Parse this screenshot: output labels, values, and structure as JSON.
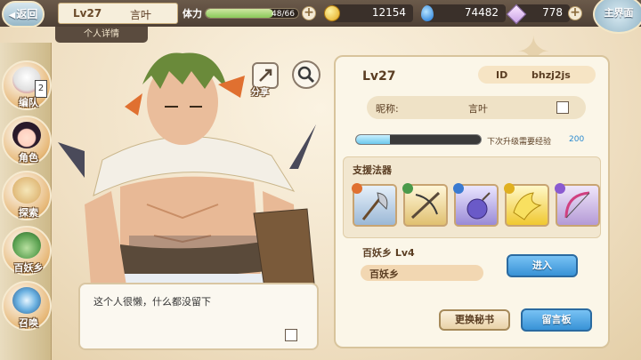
{
  "topbar": {
    "back_label": "返回",
    "level": "Lv27",
    "name": "言叶",
    "stamina_label": "体力",
    "stamina_text": "48/66",
    "stamina_fraction": 0.727,
    "gold": "12154",
    "crystal": "74482",
    "gem": "778",
    "home_label": "主界面"
  },
  "tab": {
    "label": "个人详情"
  },
  "sidebar": {
    "items": [
      {
        "label": "编队",
        "badge": "2"
      },
      {
        "label": "角色"
      },
      {
        "label": "探索"
      },
      {
        "label": "百妖乡"
      },
      {
        "label": "召唤"
      }
    ]
  },
  "actions": {
    "share_label": "分享"
  },
  "signature": {
    "text": "这个人很懒，什么都没留下"
  },
  "profile": {
    "level": "Lv27",
    "id_label": "ID",
    "id_value": "bhzj2js",
    "nick_label": "昵称:",
    "nick_value": "言叶",
    "exp_label": "下次升级需要经验",
    "exp_value": "200",
    "exp_fraction": 0.27,
    "support_title": "支援法器",
    "support_items": [
      {
        "icon": "axe-icon"
      },
      {
        "icon": "crossbow-icon"
      },
      {
        "icon": "bomb-icon"
      },
      {
        "icon": "wings-icon"
      },
      {
        "icon": "bow-icon"
      }
    ],
    "realm_label": "百妖乡 Lv4",
    "realm_name": "百妖乡",
    "enter_label": "进入",
    "change_secretary": "更换秘书",
    "message_board": "留言板"
  },
  "colors": {
    "accent_blue": "#3892d6",
    "panel_bg": "#fbf6e8",
    "stamina": "#8ac85a"
  }
}
